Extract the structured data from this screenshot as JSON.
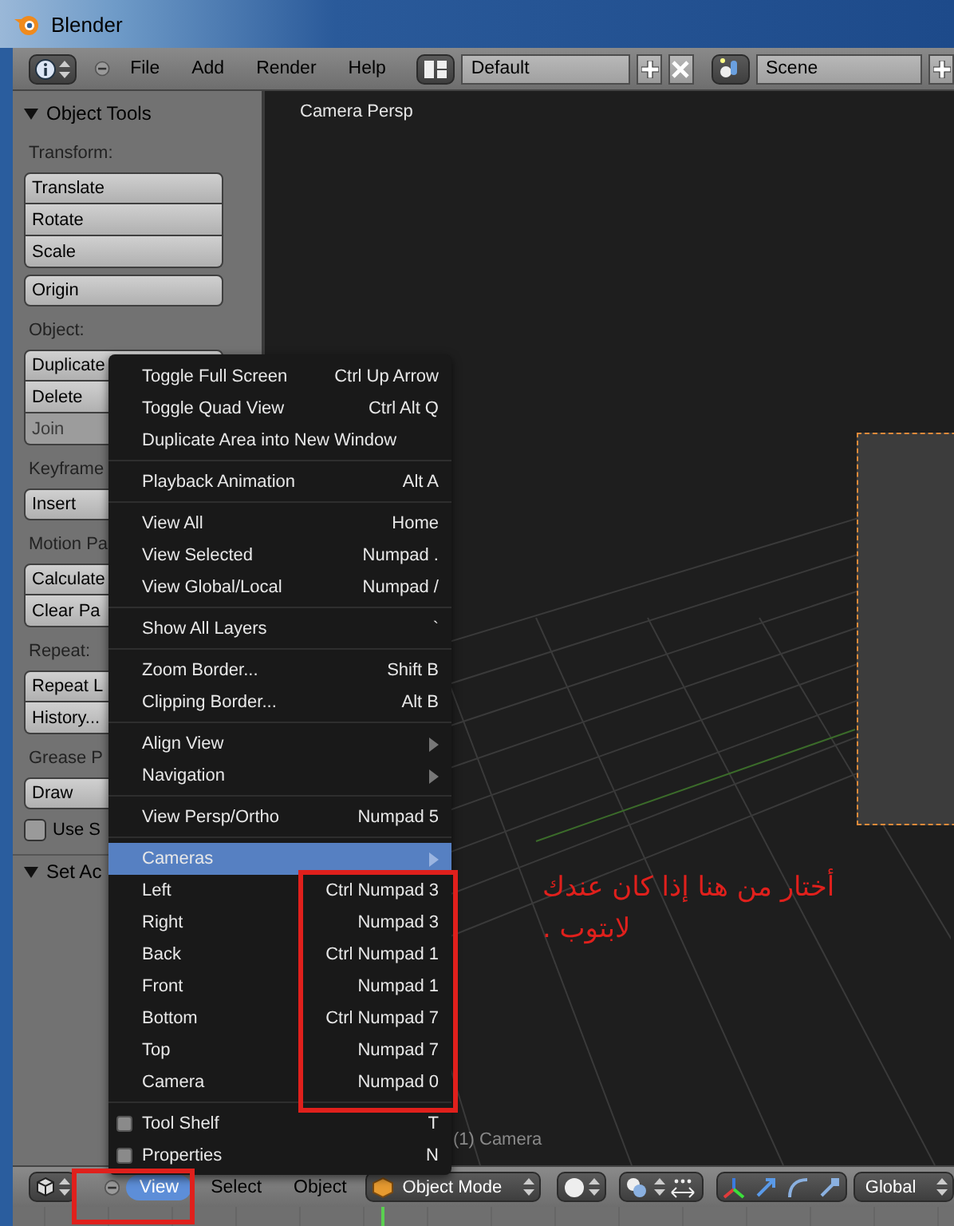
{
  "window": {
    "title": "Blender"
  },
  "top_header": {
    "menus": [
      "File",
      "Add",
      "Render",
      "Help"
    ],
    "layout": {
      "value": "Default"
    },
    "scene": {
      "value": "Scene"
    }
  },
  "tool_shelf": {
    "title": "Object Tools",
    "expanded": true,
    "rows": [
      {
        "kind": "heading",
        "text": "Transform:"
      },
      {
        "kind": "stack",
        "buttons": [
          {
            "label": "Translate",
            "disabled": false
          },
          {
            "label": "Rotate",
            "disabled": false
          },
          {
            "label": "Scale",
            "disabled": false
          }
        ]
      },
      {
        "kind": "stack",
        "buttons": [
          {
            "label": "Origin",
            "disabled": false
          }
        ]
      },
      {
        "kind": "heading",
        "text": "Object:"
      },
      {
        "kind": "stack",
        "buttons": [
          {
            "label": "Duplicate",
            "disabled": false
          },
          {
            "label": "Delete",
            "disabled": false
          },
          {
            "label": "Join",
            "disabled": true
          }
        ]
      },
      {
        "kind": "heading",
        "text": "Keyframe"
      },
      {
        "kind": "stack",
        "buttons": [
          {
            "label": "Insert",
            "disabled": false
          }
        ]
      },
      {
        "kind": "heading",
        "text": "Motion Pa"
      },
      {
        "kind": "stack",
        "buttons": [
          {
            "label": "Calculate",
            "disabled": false
          },
          {
            "label": "Clear Pa",
            "disabled": false
          }
        ]
      },
      {
        "kind": "heading",
        "text": "Repeat:"
      },
      {
        "kind": "stack",
        "buttons": [
          {
            "label": "Repeat L",
            "disabled": false
          },
          {
            "label": "History...",
            "disabled": false
          }
        ]
      },
      {
        "kind": "heading",
        "text": "Grease P"
      },
      {
        "kind": "stack",
        "buttons": [
          {
            "label": "Draw",
            "disabled": false
          }
        ]
      },
      {
        "kind": "check",
        "label": "Use S",
        "checked": false
      }
    ],
    "next_panel": {
      "title": "Set Ac",
      "expanded": true
    }
  },
  "viewport": {
    "label": "Camera Persp",
    "object_label": "(1) Camera"
  },
  "view_menu": {
    "groups": [
      [
        {
          "kind": "item",
          "label": "Toggle Full Screen",
          "shortcut": "Ctrl Up Arrow",
          "selected": false
        },
        {
          "kind": "item",
          "label": "Toggle Quad View",
          "shortcut": "Ctrl Alt Q",
          "selected": false
        },
        {
          "kind": "item",
          "label": "Duplicate Area into New Window",
          "selected": false
        }
      ],
      [
        {
          "kind": "item",
          "label": "Playback Animation",
          "shortcut": "Alt A",
          "selected": false
        }
      ],
      [
        {
          "kind": "item",
          "label": "View All",
          "shortcut": "Home",
          "selected": false
        },
        {
          "kind": "item",
          "label": "View Selected",
          "shortcut": "Numpad .",
          "selected": false
        },
        {
          "kind": "item",
          "label": "View Global/Local",
          "shortcut": "Numpad /",
          "selected": false
        }
      ],
      [
        {
          "kind": "item",
          "label": "Show All Layers",
          "shortcut": "`",
          "selected": false
        }
      ],
      [
        {
          "kind": "item",
          "label": "Zoom Border...",
          "shortcut": "Shift B",
          "selected": false
        },
        {
          "kind": "item",
          "label": "Clipping Border...",
          "shortcut": "Alt B",
          "selected": false
        }
      ],
      [
        {
          "kind": "submenu",
          "label": "Align View",
          "selected": false
        },
        {
          "kind": "submenu",
          "label": "Navigation",
          "selected": false
        }
      ],
      [
        {
          "kind": "item",
          "label": "View Persp/Ortho",
          "shortcut": "Numpad 5",
          "selected": false
        }
      ],
      [
        {
          "kind": "submenu",
          "label": "Cameras",
          "selected": true
        },
        {
          "kind": "item",
          "label": "Left",
          "shortcut": "Ctrl Numpad 3",
          "selected": false
        },
        {
          "kind": "item",
          "label": "Right",
          "shortcut": "Numpad 3",
          "selected": false
        },
        {
          "kind": "item",
          "label": "Back",
          "shortcut": "Ctrl Numpad 1",
          "selected": false
        },
        {
          "kind": "item",
          "label": "Front",
          "shortcut": "Numpad 1",
          "selected": false
        },
        {
          "kind": "item",
          "label": "Bottom",
          "shortcut": "Ctrl Numpad 7",
          "selected": false
        },
        {
          "kind": "item",
          "label": "Top",
          "shortcut": "Numpad 7",
          "selected": false
        },
        {
          "kind": "item",
          "label": "Camera",
          "shortcut": "Numpad 0",
          "selected": false
        }
      ],
      [
        {
          "kind": "check",
          "label": "Tool Shelf",
          "shortcut": "T",
          "checked": false,
          "selected": false
        },
        {
          "kind": "check",
          "label": "Properties",
          "shortcut": "N",
          "checked": false,
          "selected": false
        }
      ]
    ]
  },
  "bottom_header": {
    "menus": [
      {
        "label": "View",
        "selected": true
      },
      {
        "label": "Select",
        "selected": false
      },
      {
        "label": "Object",
        "selected": false
      }
    ],
    "mode": "Object Mode",
    "orientation": "Global"
  },
  "annotation": {
    "lines": [
      "أختار من هنا إذا كان عندك",
      "لابتوب ."
    ]
  }
}
